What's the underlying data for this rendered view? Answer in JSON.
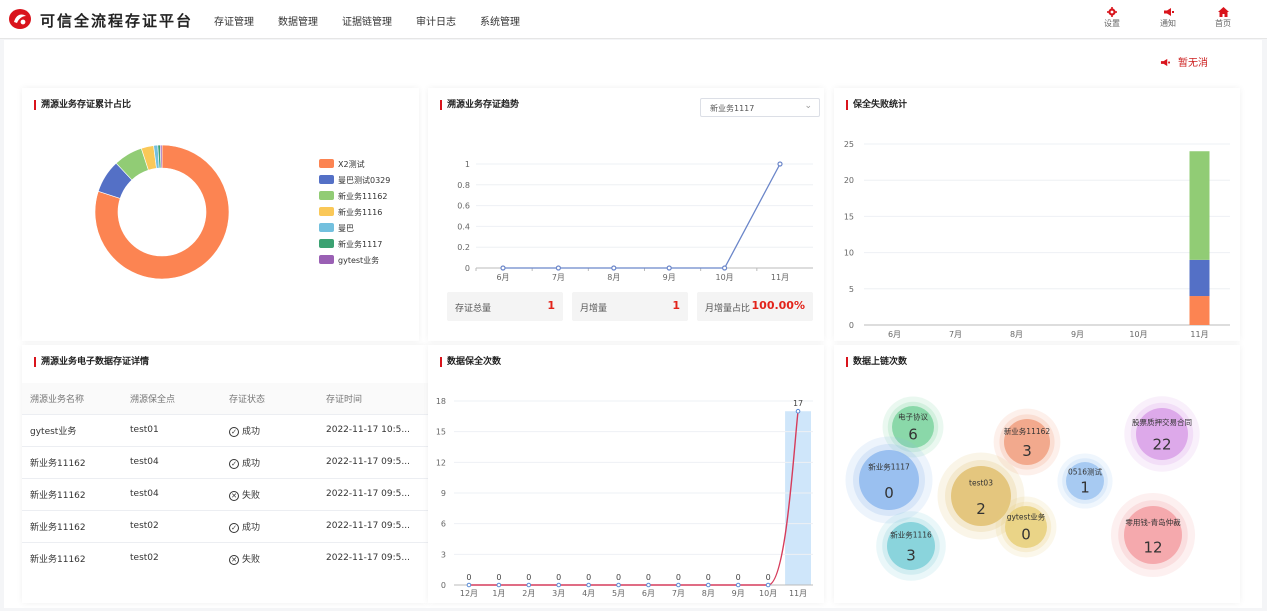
{
  "header": {
    "brand": "可信全流程存证平台",
    "nav": [
      "存证管理",
      "数据管理",
      "证据链管理",
      "审计日志",
      "系统管理"
    ],
    "settings_label": "设置",
    "notify_label": "通知",
    "home_label": "首页"
  },
  "notice": {
    "text": "暂无消"
  },
  "panels": {
    "pie_title": "溯源业务存证累计占比",
    "trend_title": "溯源业务存证趋势",
    "trend_select": "新业务1117",
    "fail_title": "保全失败统计",
    "table_title": "溯源业务电子数据存证详情",
    "save_title": "数据保全次数",
    "chain_title": "数据上链次数"
  },
  "stats": [
    {
      "label": "存证总量",
      "value": "1"
    },
    {
      "label": "月增量",
      "value": "1"
    },
    {
      "label": "月增量占比",
      "value": "100.00%"
    }
  ],
  "table": {
    "headers": [
      "溯源业务名称",
      "溯源保全点",
      "存证状态",
      "存证时间"
    ],
    "rows": [
      {
        "name": "gytest业务",
        "point": "test01",
        "status": "成功",
        "ok": true,
        "time": "2022-11-17 10:5..."
      },
      {
        "name": "新业务11162",
        "point": "test04",
        "status": "成功",
        "ok": true,
        "time": "2022-11-17 09:5..."
      },
      {
        "name": "新业务11162",
        "point": "test04",
        "status": "失败",
        "ok": false,
        "time": "2022-11-17 09:5..."
      },
      {
        "name": "新业务11162",
        "point": "test02",
        "status": "成功",
        "ok": true,
        "time": "2022-11-17 09:5..."
      },
      {
        "name": "新业务11162",
        "point": "test02",
        "status": "失败",
        "ok": false,
        "time": "2022-11-17 09:5..."
      }
    ]
  },
  "colors": {
    "brand_red": "#d9141c",
    "success": "#67c23a",
    "fail": "#f56c6c"
  },
  "chart_data": [
    {
      "type": "pie",
      "title": "溯源业务存证累计占比",
      "donut": true,
      "legend_position": "right",
      "slices": [
        {
          "name": "X2测试",
          "value": 80,
          "color": "#fc8452"
        },
        {
          "name": "曼巴测试0329",
          "value": 8,
          "color": "#5470c6"
        },
        {
          "name": "新业务11162",
          "value": 7,
          "color": "#91cc75"
        },
        {
          "name": "新业务1116",
          "value": 3,
          "color": "#fac858"
        },
        {
          "name": "曼巴",
          "value": 1,
          "color": "#73c0de"
        },
        {
          "name": "新业务1117",
          "value": 0.6,
          "color": "#3ba272"
        },
        {
          "name": "gytest业务",
          "value": 0.4,
          "color": "#9a60b4"
        }
      ]
    },
    {
      "type": "line",
      "title": "溯源业务存证趋势",
      "categories": [
        "6月",
        "7月",
        "8月",
        "9月",
        "10月",
        "11月"
      ],
      "values": [
        0,
        0,
        0,
        0,
        0,
        1
      ],
      "yticks": [
        "0",
        "0.2",
        "0.4",
        "0.6",
        "0.8",
        "1"
      ],
      "ylim": [
        0,
        1
      ],
      "color": "#6b86c9"
    },
    {
      "type": "bar",
      "title": "保全失败统计",
      "stacked": true,
      "categories": [
        "6月",
        "7月",
        "8月",
        "9月",
        "10月",
        "11月"
      ],
      "yticks": [
        "0",
        "5",
        "10",
        "15",
        "20",
        "25"
      ],
      "ylim": [
        0,
        25
      ],
      "series": [
        {
          "values": [
            0,
            0,
            0,
            0,
            0,
            4
          ],
          "color": "#fc8452"
        },
        {
          "values": [
            0,
            0,
            0,
            0,
            0,
            5
          ],
          "color": "#5470c6"
        },
        {
          "values": [
            0,
            0,
            0,
            0,
            0,
            15
          ],
          "color": "#91cc75"
        }
      ]
    },
    {
      "type": "line",
      "title": "数据保全次数",
      "categories": [
        "12月",
        "1月",
        "2月",
        "3月",
        "4月",
        "5月",
        "6月",
        "7月",
        "8月",
        "9月",
        "10月",
        "11月"
      ],
      "values": [
        0,
        0,
        0,
        0,
        0,
        0,
        0,
        0,
        0,
        0,
        0,
        17
      ],
      "yticks": [
        "0",
        "3",
        "6",
        "9",
        "12",
        "15",
        "18"
      ],
      "ylim": [
        0,
        18
      ],
      "highlight_category": "11月",
      "color": "#d63c5b"
    },
    {
      "type": "scatter",
      "title": "数据上链次数",
      "bubbles": [
        {
          "name": "电子协议",
          "value": "6",
          "color": "#7ed4a0"
        },
        {
          "name": "新业务11162",
          "value": "3",
          "color": "#f0a080"
        },
        {
          "name": "股票质押交易合同",
          "value": "22",
          "color": "#d9a0e8"
        },
        {
          "name": "新业务1117",
          "value": "0",
          "color": "#8fb8ee"
        },
        {
          "name": "test03",
          "value": "2",
          "color": "#e0c070"
        },
        {
          "name": "0516测试",
          "value": "1",
          "color": "#9ec4f0"
        },
        {
          "name": "gytest业务",
          "value": "0",
          "color": "#e8cf7a"
        },
        {
          "name": "零用钱-青岛仲裁",
          "value": "12",
          "color": "#f3a0a4"
        },
        {
          "name": "新业务1116",
          "value": "3",
          "color": "#7ecfd8"
        }
      ]
    }
  ]
}
